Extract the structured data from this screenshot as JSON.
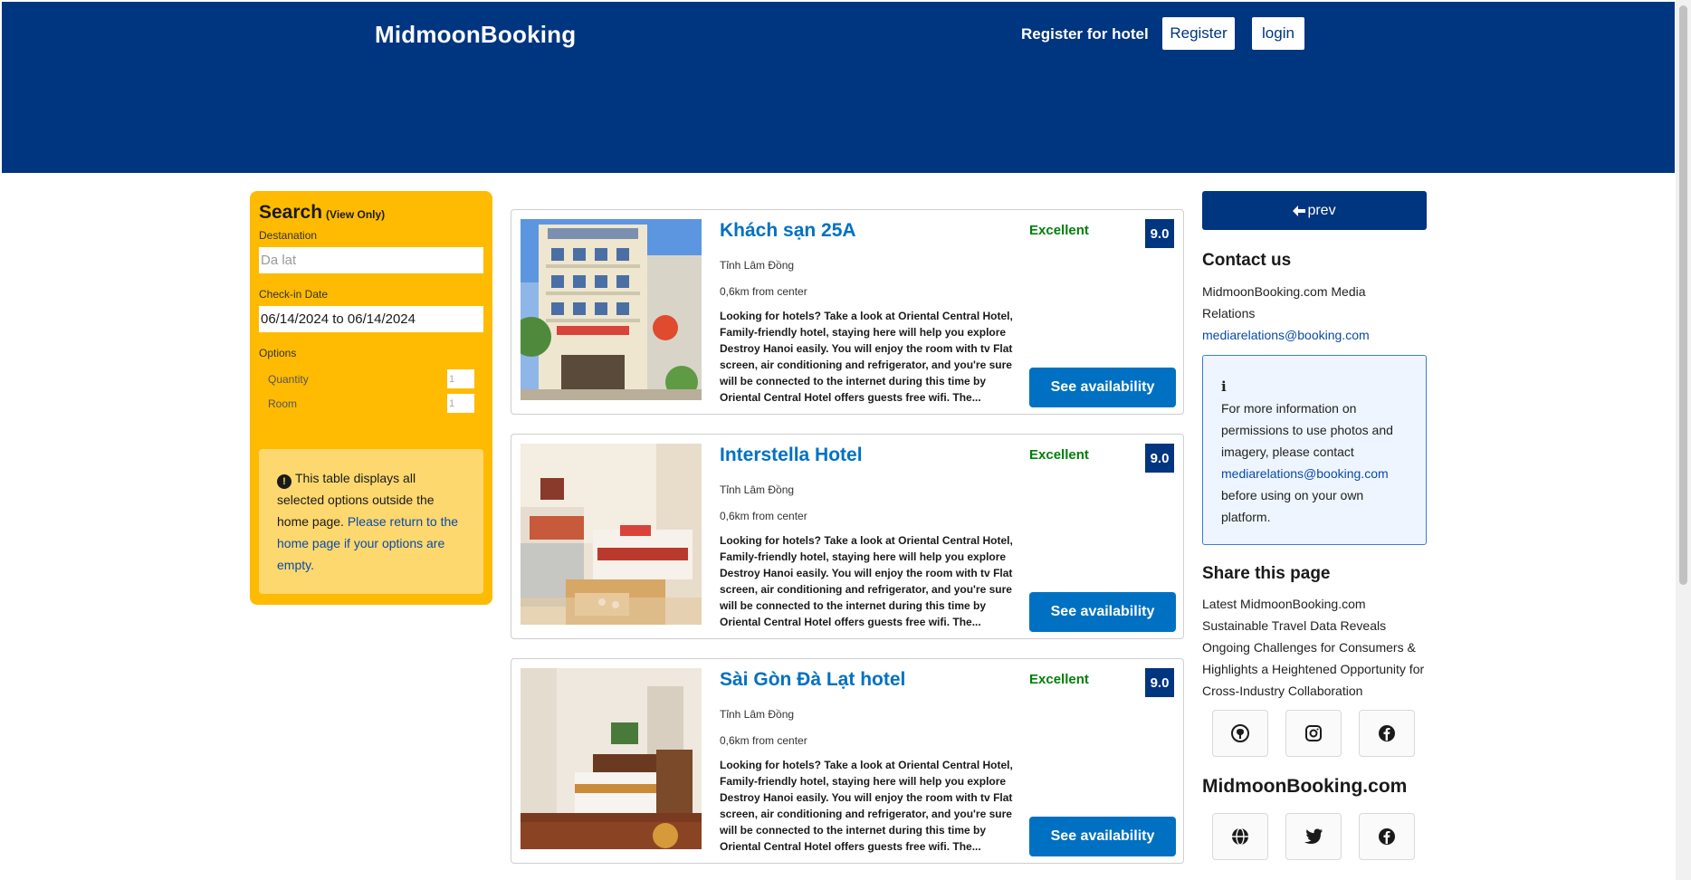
{
  "header": {
    "brand": "MidmoonBooking",
    "register_for_hotel": "Register for hotel",
    "register_label": "Register",
    "login_label": "login"
  },
  "search": {
    "title": "Search",
    "view_only": "(View Only)",
    "destination_label": "Destanation",
    "destination_placeholder": "Da lat",
    "checkin_label": "Check-in Date",
    "checkin_value": "06/14/2024 to 06/14/2024",
    "options_label": "Options",
    "quantity_label": "Quantity",
    "quantity_value": "1",
    "room_label": "Room",
    "room_value": "1",
    "note_text": "This table displays all selected options outside the home page.",
    "note_link": "Please return to the home page if your options are empty."
  },
  "hotels": [
    {
      "name": "Khách sạn 25A",
      "region": "Tỉnh Lâm Đồng",
      "distance": "0,6km from center",
      "description": "Looking for hotels? Take a look at Oriental Central Hotel, Family-friendly hotel, staying here will help you explore Destroy Hanoi easily. You will enjoy the room with tv Flat screen, air conditioning and refrigerator, and you're sure will be connected to the internet during this time by Oriental Central Hotel offers guests free wifi. The...",
      "rating_text": "Excellent",
      "score": "9.0",
      "button": "See availability"
    },
    {
      "name": "Interstella Hotel",
      "region": "Tỉnh Lâm Đồng",
      "distance": "0,6km from center",
      "description": "Looking for hotels? Take a look at Oriental Central Hotel, Family-friendly hotel, staying here will help you explore Destroy Hanoi easily. You will enjoy the room with tv Flat screen, air conditioning and refrigerator, and you're sure will be connected to the internet during this time by Oriental Central Hotel offers guests free wifi. The...",
      "rating_text": "Excellent",
      "score": "9.0",
      "button": "See availability"
    },
    {
      "name": "Sài Gòn Đà Lạt hotel",
      "region": "Tỉnh Lâm Đồng",
      "distance": "0,6km from center",
      "description": "Looking for hotels? Take a look at Oriental Central Hotel, Family-friendly hotel, staying here will help you explore Destroy Hanoi easily. You will enjoy the room with tv Flat screen, air conditioning and refrigerator, and you're sure will be connected to the internet during this time by Oriental Central Hotel offers guests free wifi. The...",
      "rating_text": "Excellent",
      "score": "9.0",
      "button": "See availability"
    }
  ],
  "sidebar_right": {
    "prev_label": "prev",
    "contact_title": "Contact us",
    "contact_text": "MidmoonBooking.com Media Relations",
    "contact_email": "mediarelations@booking.com",
    "info_icon": "i",
    "info_text_1": "For more information on permissions to use photos and imagery, please contact",
    "info_email": "mediarelations@booking.com",
    "info_text_2": "before using on your own platform.",
    "share_title": "Share this page",
    "share_text": "Latest MidmoonBooking.com Sustainable Travel Data Reveals Ongoing Challenges for Consumers & Highlights a Heightened Opportunity for Cross-Industry Collaboration",
    "brand_footer": "MidmoonBooking.com",
    "social_icons_row1": [
      "github-icon",
      "instagram-icon",
      "facebook-icon"
    ],
    "social_icons_row2": [
      "globe-icon",
      "twitter-icon",
      "facebook-icon"
    ]
  },
  "colors": {
    "header_bg": "#003580",
    "search_bg": "#febb02",
    "accent_blue": "#0071c2",
    "rating_green": "#008009"
  }
}
